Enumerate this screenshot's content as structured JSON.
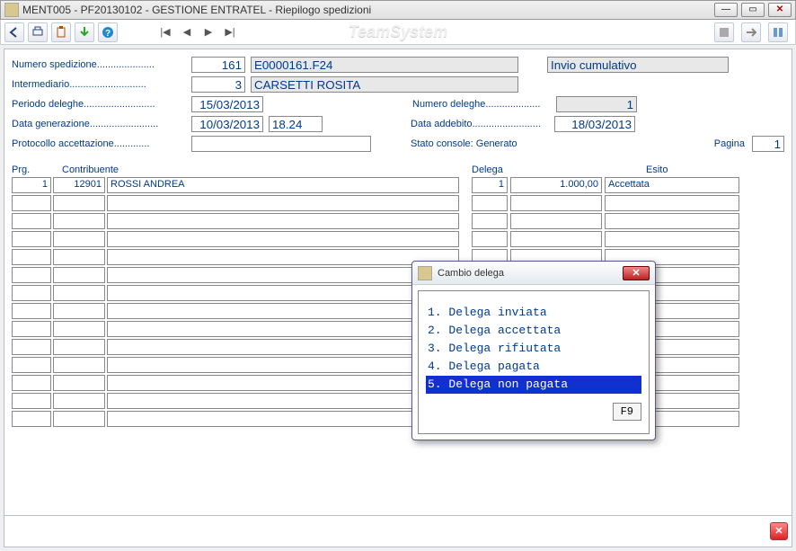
{
  "window": {
    "title": "MENT005 - PF20130102 - GESTIONE ENTRATEL - Riepilogo spedizioni",
    "brand": "TeamSystem"
  },
  "toolbar": {
    "icons": [
      "back",
      "print",
      "clipboard",
      "download",
      "help"
    ]
  },
  "form": {
    "numero_spedizione_label": "Numero spedizione.....................",
    "numero_spedizione": "161",
    "file_code": "E0000161.F24",
    "invio_cumulativo_label": "Invio cumulativo",
    "invio_cumulativo": "",
    "intermediario_label": "Intermediario............................",
    "intermediario_code": "3",
    "intermediario_nome": "CARSETTI ROSITA",
    "periodo_deleghe_label": "Periodo deleghe..........................",
    "periodo_deleghe": "15/03/2013",
    "numero_deleghe_label": "Numero deleghe....................",
    "numero_deleghe": "1",
    "data_generazione_label": "Data generazione.........................",
    "data_generazione": "10/03/2013",
    "ora_generazione": "18.24",
    "data_addebito_label": "Data addebito.........................",
    "data_addebito": "18/03/2013",
    "protocollo_label": "Protocollo accettazione.............",
    "protocollo": "",
    "stato_console_label": "Stato console: Generato",
    "pagina_label": "Pagina",
    "pagina": "1"
  },
  "columns": {
    "prg": "Prg.",
    "contribuente": "Contribuente",
    "delega": "Delega",
    "esito": "Esito"
  },
  "rows": [
    {
      "prg": "1",
      "code": "12901",
      "name": "ROSSI ANDREA",
      "delega": "1",
      "amount": "1.000,00",
      "esito": "Accettata"
    }
  ],
  "dialog": {
    "title": "Cambio delega",
    "items": [
      "1. Delega inviata",
      "2. Delega accettata",
      "3. Delega rifiutata",
      "4. Delega pagata",
      "5. Delega non pagata"
    ],
    "selected_index": 4,
    "f9": "F9"
  }
}
